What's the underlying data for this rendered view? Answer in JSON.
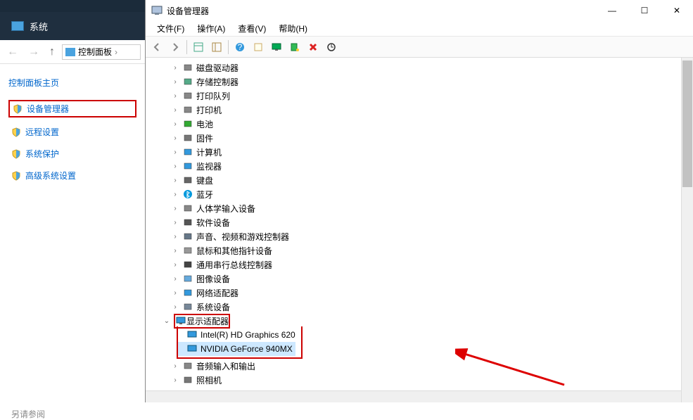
{
  "left": {
    "top_dark_text": "",
    "system_label": "系统",
    "breadcrumb": "控制面板",
    "main_link": "控制面板主页",
    "links": [
      {
        "label": "设备管理器",
        "boxed": true
      },
      {
        "label": "远程设置",
        "boxed": false
      },
      {
        "label": "系统保护",
        "boxed": false
      },
      {
        "label": "高级系统设置",
        "boxed": false
      }
    ],
    "see_also": "另请参阅"
  },
  "dm": {
    "title": "设备管理器",
    "menu": [
      "文件(F)",
      "操作(A)",
      "查看(V)",
      "帮助(H)"
    ],
    "toolbar_icons": [
      "back",
      "forward",
      "table",
      "tree",
      "help",
      "props",
      "monitor",
      "scan",
      "delete",
      "update"
    ],
    "categories": [
      {
        "icon": "disk",
        "label": "磁盘驱动器"
      },
      {
        "icon": "storage",
        "label": "存储控制器"
      },
      {
        "icon": "printer",
        "label": "打印队列"
      },
      {
        "icon": "printer",
        "label": "打印机"
      },
      {
        "icon": "battery",
        "label": "电池"
      },
      {
        "icon": "firmware",
        "label": "固件"
      },
      {
        "icon": "computer",
        "label": "计算机"
      },
      {
        "icon": "monitor",
        "label": "监视器"
      },
      {
        "icon": "keyboard",
        "label": "键盘"
      },
      {
        "icon": "bluetooth",
        "label": "蓝牙"
      },
      {
        "icon": "hid",
        "label": "人体学输入设备"
      },
      {
        "icon": "software",
        "label": "软件设备"
      },
      {
        "icon": "audio",
        "label": "声音、视频和游戏控制器"
      },
      {
        "icon": "mouse",
        "label": "鼠标和其他指针设备"
      },
      {
        "icon": "usb",
        "label": "通用串行总线控制器"
      },
      {
        "icon": "imaging",
        "label": "图像设备"
      },
      {
        "icon": "network",
        "label": "网络适配器"
      },
      {
        "icon": "system",
        "label": "系统设备"
      }
    ],
    "display_adapters": {
      "label": "显示适配器",
      "children": [
        {
          "label": "Intel(R) HD Graphics 620",
          "selected": false
        },
        {
          "label": "NVIDIA GeForce 940MX",
          "selected": true
        }
      ]
    },
    "after_categories": [
      {
        "icon": "audioinput",
        "label": "音频输入和输出"
      },
      {
        "icon": "camera",
        "label": "照相机"
      }
    ]
  }
}
